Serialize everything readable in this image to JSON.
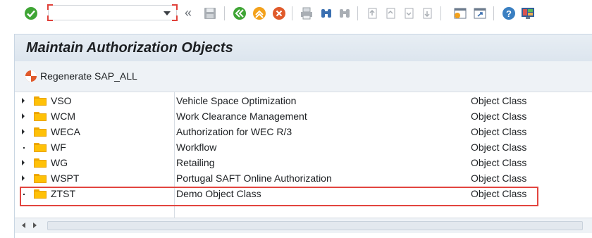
{
  "toolbar": {
    "command_field_value": "",
    "more_label": "«",
    "icons": [
      "enter-icon",
      "command-field",
      "save-icon",
      "back-icon",
      "exit-icon",
      "cancel-icon",
      "print-icon",
      "find-icon",
      "find-next-icon",
      "first-page-icon",
      "previous-page-icon",
      "next-page-icon",
      "last-page-icon",
      "create-session-icon",
      "shortcut-icon",
      "help-icon",
      "customize-layout-icon"
    ]
  },
  "page": {
    "title": "Maintain Authorization Objects",
    "regenerate_label": "Regenerate SAP_ALL"
  },
  "tree": {
    "rows": [
      {
        "name": "VSO",
        "description": "Vehicle Space Optimization",
        "type": "Object Class",
        "expandable": true
      },
      {
        "name": "WCM",
        "description": "Work Clearance Management",
        "type": "Object Class",
        "expandable": true
      },
      {
        "name": "WECA",
        "description": "Authorization for WEC R/3",
        "type": "Object Class",
        "expandable": true
      },
      {
        "name": "WF",
        "description": "Workflow",
        "type": "Object Class",
        "expandable": false
      },
      {
        "name": "WG",
        "description": "Retailing",
        "type": "Object Class",
        "expandable": true
      },
      {
        "name": "WSPT",
        "description": "Portugal SAFT Online Authorization",
        "type": "Object Class",
        "expandable": true
      },
      {
        "name": "ZTST",
        "description": "Demo Object Class",
        "type": "Object Class",
        "expandable": false
      }
    ]
  },
  "colors": {
    "highlight": "#e2453f",
    "folder": "#ffc107",
    "title_bg": "#dce5ee"
  }
}
